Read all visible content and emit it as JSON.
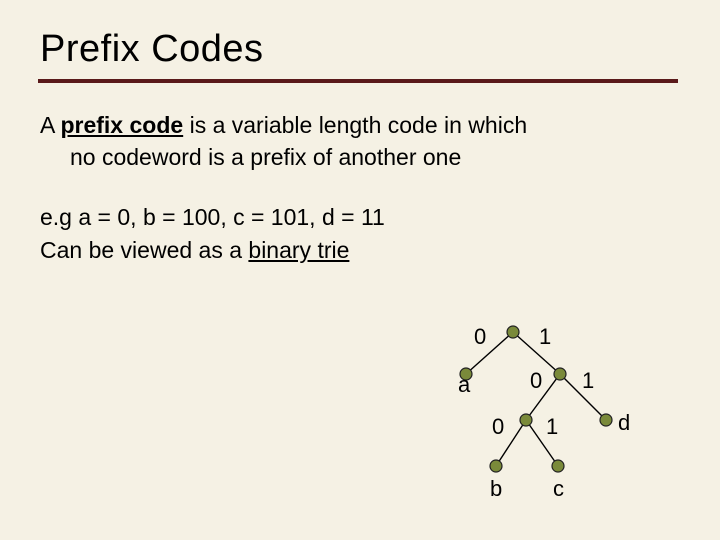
{
  "title": "Prefix Codes",
  "para1_a": "A ",
  "para1_b": "prefix code",
  "para1_c": " is a variable length code in which",
  "para1_line2": "no codeword is a prefix of another one",
  "eg": "e.g a = 0, b = 100, c = 101, d = 11",
  "view_a": "Can be viewed as a ",
  "view_b": "binary trie",
  "trie": {
    "e0": "0",
    "e1": "1",
    "e2": "0",
    "e3": "1",
    "e4": "0",
    "e5": "1",
    "la": "a",
    "lb": "b",
    "lc": "c",
    "ld": "d"
  },
  "chart_data": {
    "type": "table",
    "title": "Binary trie for prefix code",
    "symbol_codes": [
      {
        "symbol": "a",
        "code": "0"
      },
      {
        "symbol": "b",
        "code": "100"
      },
      {
        "symbol": "c",
        "code": "101"
      },
      {
        "symbol": "d",
        "code": "11"
      }
    ],
    "edges": [
      {
        "from": "root",
        "to": "a",
        "label": "0"
      },
      {
        "from": "root",
        "to": "n1",
        "label": "1"
      },
      {
        "from": "n1",
        "to": "n2",
        "label": "0"
      },
      {
        "from": "n1",
        "to": "d",
        "label": "1"
      },
      {
        "from": "n2",
        "to": "b",
        "label": "0"
      },
      {
        "from": "n2",
        "to": "c",
        "label": "1"
      }
    ]
  }
}
